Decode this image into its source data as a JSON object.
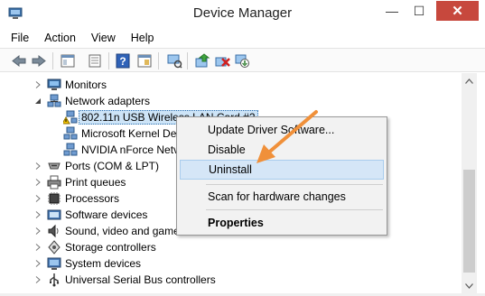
{
  "window": {
    "title": "Device Manager",
    "minimize_glyph": "—",
    "maximize_glyph": "☐",
    "close_glyph": "✕"
  },
  "menu": [
    "File",
    "Action",
    "View",
    "Help"
  ],
  "toolbar": {
    "icons": [
      "back-icon",
      "forward-icon",
      "properties-view-icon",
      "properties-icon",
      "help-icon",
      "resources-view-icon",
      "display-devices-icon",
      "scan-hardware-icon",
      "update-driver-icon",
      "uninstall-device-icon",
      "enable-device-icon"
    ]
  },
  "tree": {
    "monitors": "Monitors",
    "network_adapters": "Network adapters",
    "adapter_1": "802.11n USB Wireless LAN Card #2",
    "adapter_2": "Microsoft Kernel De",
    "adapter_3": "NVIDIA nForce Netv",
    "ports": "Ports (COM & LPT)",
    "print_queues": "Print queues",
    "processors": "Processors",
    "software_devices": "Software devices",
    "sound": "Sound, video and game",
    "storage": "Storage controllers",
    "system_devices": "System devices",
    "usb": "Universal Serial Bus controllers"
  },
  "context_menu": {
    "update": "Update Driver Software...",
    "disable": "Disable",
    "uninstall": "Uninstall",
    "scan": "Scan for hardware changes",
    "properties": "Properties"
  },
  "colors": {
    "close_button": "#c7483d",
    "highlight": "#d5e6f7",
    "arrow": "#f0903a"
  }
}
